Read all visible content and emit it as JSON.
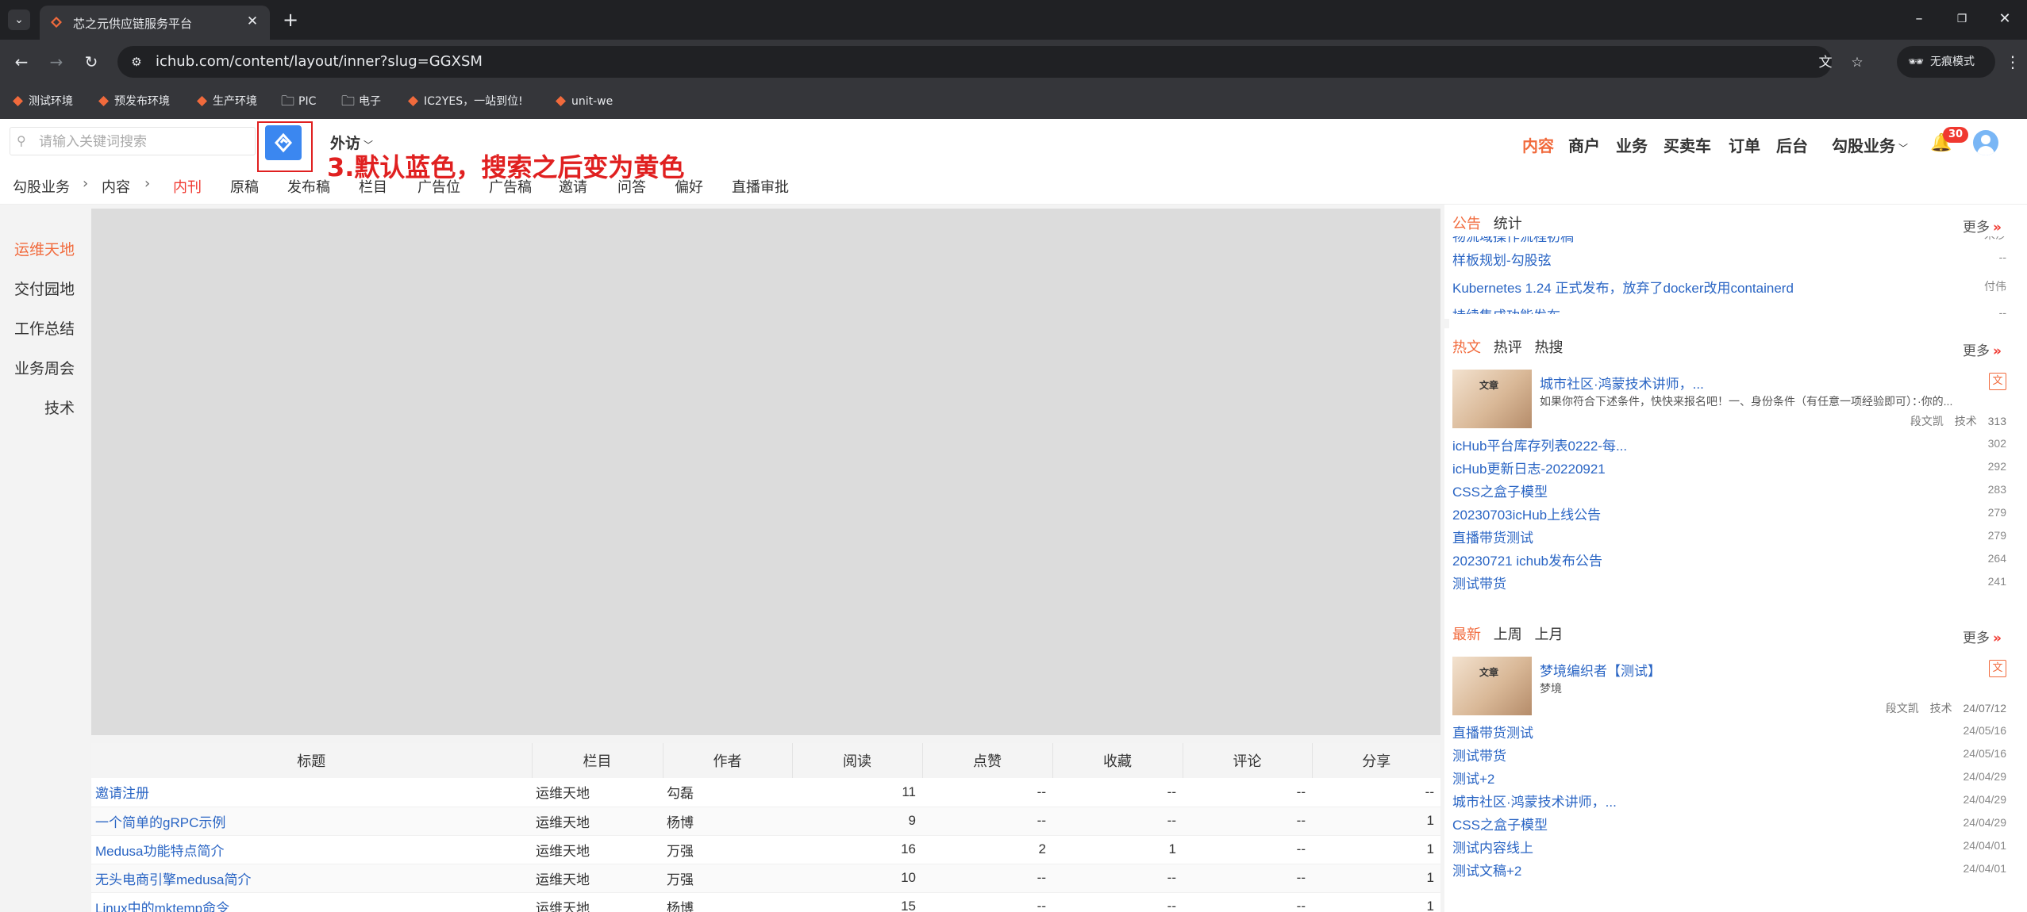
{
  "browser": {
    "tab_title": "芯之元供应链服务平台",
    "url": "ichub.com/content/layout/inner?slug=GGXSM",
    "incognito_label": "无痕模式",
    "bookmarks": [
      {
        "label": "测试环境",
        "icon": "ichub-logo"
      },
      {
        "label": "预发布环境",
        "icon": "ichub-logo"
      },
      {
        "label": "生产环境",
        "icon": "ichub-logo"
      },
      {
        "label": "PIC",
        "icon": "folder"
      },
      {
        "label": "电子",
        "icon": "folder"
      },
      {
        "label": "IC2YES，一站到位!",
        "icon": "ichub-logo"
      },
      {
        "label": "unit-we",
        "icon": "ichub-logo"
      }
    ]
  },
  "header": {
    "search_placeholder": "请输入关键词搜索",
    "annotation": "3.默认蓝色，搜索之后变为黄色",
    "waifang": "外访",
    "nav": [
      "内容",
      "商户",
      "业务",
      "买卖车",
      "订单",
      "后台",
      "勾股业务"
    ],
    "notification_count": "30"
  },
  "subnav": {
    "breadcrumb": [
      "勾股业务",
      "内容"
    ],
    "items": [
      "内刊",
      "原稿",
      "发布稿",
      "栏目",
      "广告位",
      "广告稿",
      "邀请",
      "问答",
      "偏好",
      "直播审批"
    ]
  },
  "sidebar": [
    "运维天地",
    "交付园地",
    "工作总结",
    "业务周会",
    "技术"
  ],
  "table": {
    "headers": [
      "标题",
      "栏目",
      "作者",
      "阅读",
      "点赞",
      "收藏",
      "评论",
      "分享"
    ],
    "rows": [
      [
        "邀请注册",
        "运维天地",
        "勾磊",
        "11",
        "--",
        "--",
        "--",
        "--"
      ],
      [
        "一个简单的gRPC示例",
        "运维天地",
        "杨博",
        "9",
        "--",
        "--",
        "--",
        "1"
      ],
      [
        "Medusa功能特点简介",
        "运维天地",
        "万强",
        "16",
        "2",
        "1",
        "--",
        "1"
      ],
      [
        "无头电商引擎medusa简介",
        "运维天地",
        "万强",
        "10",
        "--",
        "--",
        "--",
        "1"
      ],
      [
        "Linux中的mktemp命令",
        "运维天地",
        "杨博",
        "15",
        "--",
        "--",
        "--",
        "1"
      ]
    ]
  },
  "panel_notice": {
    "tabs": [
      "公告",
      "统计"
    ],
    "more": "更多",
    "items": [
      {
        "title": "物流域操作流程初稿",
        "value": "宋沙"
      },
      {
        "title": "样板规划-勾股弦",
        "value": "--"
      },
      {
        "title": "Kubernetes 1.24 正式发布，放弃了docker改用containerd",
        "value": "付伟"
      },
      {
        "title": "持续集成功能发布",
        "value": "--"
      }
    ]
  },
  "panel_hot": {
    "tabs": [
      "热文",
      "热评",
      "热搜"
    ],
    "more": "更多",
    "featured": {
      "title": "城市社区·鸿蒙技术讲师，...",
      "desc": "如果你符合下述条件，快快来报名吧！一、身份条件（有任意一项经验即可）：·你的...",
      "author": "段文凯",
      "category": "技术",
      "count": "313",
      "badge": "文",
      "thumb_text": "文章"
    },
    "items": [
      {
        "title": "icHub平台库存列表0222-每...",
        "value": "302"
      },
      {
        "title": "icHub更新日志-20220921",
        "value": "292"
      },
      {
        "title": "CSS之盒子模型",
        "value": "283"
      },
      {
        "title": "20230703icHub上线公告",
        "value": "279"
      },
      {
        "title": "直播带货测试",
        "value": "279"
      },
      {
        "title": "20230721 ichub发布公告",
        "value": "264"
      },
      {
        "title": "测试带货",
        "value": "241"
      }
    ]
  },
  "panel_new": {
    "tabs": [
      "最新",
      "上周",
      "上月"
    ],
    "more": "更多",
    "featured": {
      "title": "梦境编织者【测试】",
      "desc": "梦境",
      "author": "段文凯",
      "category": "技术",
      "date": "24/07/12",
      "badge": "文",
      "thumb_text": "文章"
    },
    "items": [
      {
        "title": "直播带货测试",
        "value": "24/05/16"
      },
      {
        "title": "测试带货",
        "value": "24/05/16"
      },
      {
        "title": "测试+2",
        "value": "24/04/29"
      },
      {
        "title": "城市社区·鸿蒙技术讲师，...",
        "value": "24/04/29"
      },
      {
        "title": "CSS之盒子模型",
        "value": "24/04/29"
      },
      {
        "title": "测试内容线上",
        "value": "24/04/01"
      },
      {
        "title": "测试文稿+2",
        "value": "24/04/01"
      }
    ]
  },
  "colors": {
    "accent": "#f16a3c",
    "link": "#2a65c4",
    "search_button": "#3b87f0",
    "annotation": "#e02020"
  }
}
